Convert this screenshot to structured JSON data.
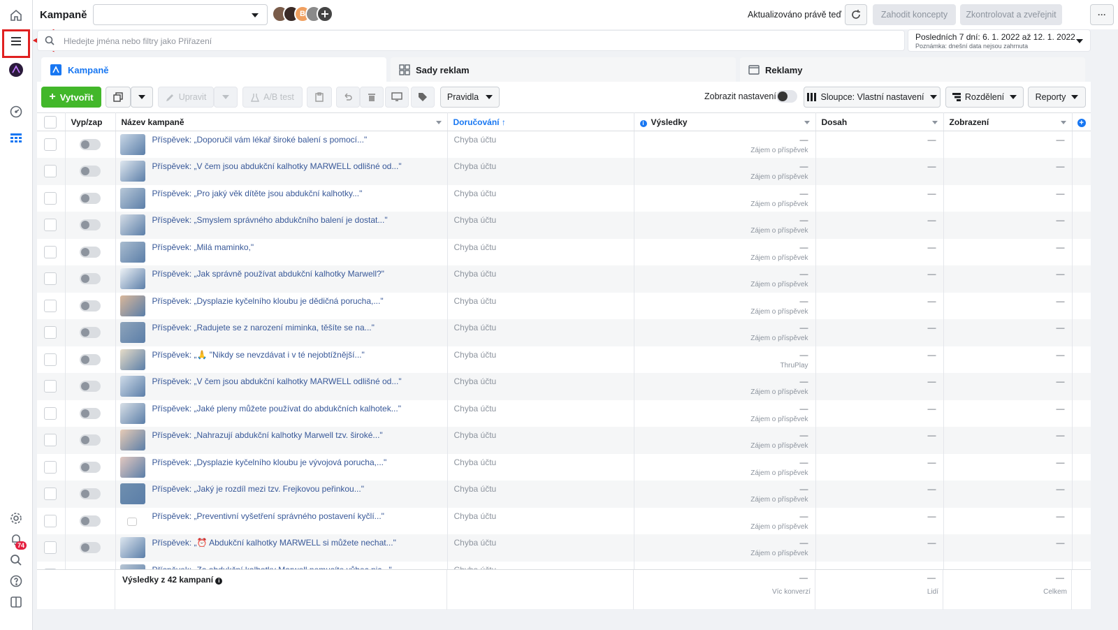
{
  "header": {
    "title": "Kampaně",
    "updated": "Aktualizováno právě teď",
    "discard_label": "Zahodit koncepty",
    "publish_label": "Zkontrolovat a zveřejnit",
    "more_label": "···",
    "avatar_letter": "B"
  },
  "search": {
    "placeholder": "Hledejte jména nebo filtry jako Přiřazení"
  },
  "date_range": {
    "label": "Posledních 7 dní: 6. 1. 2022 až 12. 1. 2022",
    "note": "Poznámka: dnešní data nejsou zahrnuta"
  },
  "tabs": {
    "campaigns": "Kampaně",
    "adsets": "Sady reklam",
    "ads": "Reklamy"
  },
  "toolbar": {
    "create": "Vytvořit",
    "edit": "Upravit",
    "ab_test": "A/B test",
    "rules": "Pravidla",
    "show_settings": "Zobrazit nastavení",
    "columns": "Sloupce: Vlastní nastavení",
    "breakdown": "Rozdělení",
    "reports": "Reporty"
  },
  "columns": {
    "onoff": "Vyp/zap",
    "name": "Název kampaně",
    "delivery": "Doručování",
    "results": "Výsledky",
    "reach": "Dosah",
    "impressions": "Zobrazení"
  },
  "rows": [
    {
      "name": "Příspěvek: „Doporučil vám lékař široké balení s pomocí...\"",
      "delivery": "Chyba účtu",
      "result": "—",
      "result_type": "Zájem o příspěvek",
      "reach": "—",
      "impressions": "—"
    },
    {
      "name": "Příspěvek: „V čem jsou abdukční kalhotky MARWELL odlišné od...\"",
      "delivery": "Chyba účtu",
      "result": "—",
      "result_type": "Zájem o příspěvek",
      "reach": "—",
      "impressions": "—"
    },
    {
      "name": "Příspěvek: „Pro jaký věk dítěte jsou abdukční kalhotky...\"",
      "delivery": "Chyba účtu",
      "result": "—",
      "result_type": "Zájem o příspěvek",
      "reach": "—",
      "impressions": "—"
    },
    {
      "name": "Příspěvek: „Smyslem správného abdukčního balení je dostat...\"",
      "delivery": "Chyba účtu",
      "result": "—",
      "result_type": "Zájem o příspěvek",
      "reach": "—",
      "impressions": "—"
    },
    {
      "name": "Příspěvek: „Milá maminko,\"",
      "delivery": "Chyba účtu",
      "result": "—",
      "result_type": "Zájem o příspěvek",
      "reach": "—",
      "impressions": "—"
    },
    {
      "name": "Příspěvek: „Jak správně používat abdukční kalhotky Marwell?\"",
      "delivery": "Chyba účtu",
      "result": "—",
      "result_type": "Zájem o příspěvek",
      "reach": "—",
      "impressions": "—"
    },
    {
      "name": "Příspěvek: „Dysplazie kyčelního kloubu je dědičná porucha,...\"",
      "delivery": "Chyba účtu",
      "result": "—",
      "result_type": "Zájem o příspěvek",
      "reach": "—",
      "impressions": "—"
    },
    {
      "name": "Příspěvek: „Radujete se z narození miminka, těšíte se na...\"",
      "delivery": "Chyba účtu",
      "result": "—",
      "result_type": "Zájem o příspěvek",
      "reach": "—",
      "impressions": "—"
    },
    {
      "name": "Příspěvek: „🙏 \"Nikdy se nevzdávat i v té nejobtížnější...\"",
      "delivery": "Chyba účtu",
      "result": "—",
      "result_type": "ThruPlay",
      "reach": "—",
      "impressions": "—"
    },
    {
      "name": "Příspěvek: „V čem jsou abdukční kalhotky MARWELL odlišné od...\"",
      "delivery": "Chyba účtu",
      "result": "—",
      "result_type": "Zájem o příspěvek",
      "reach": "—",
      "impressions": "—"
    },
    {
      "name": "Příspěvek: „Jaké pleny můžete používat do abdukčních kalhotek...\"",
      "delivery": "Chyba účtu",
      "result": "—",
      "result_type": "Zájem o příspěvek",
      "reach": "—",
      "impressions": "—"
    },
    {
      "name": "Příspěvek: „Nahrazují abdukční kalhotky Marwell tzv. široké...\"",
      "delivery": "Chyba účtu",
      "result": "—",
      "result_type": "Zájem o příspěvek",
      "reach": "—",
      "impressions": "—"
    },
    {
      "name": "Příspěvek: „Dysplazie kyčelního kloubu je vývojová porucha,...\"",
      "delivery": "Chyba účtu",
      "result": "—",
      "result_type": "Zájem o příspěvek",
      "reach": "—",
      "impressions": "—"
    },
    {
      "name": "Příspěvek: „Jaký je rozdíl mezi tzv. Frejkovou peřinkou...\"",
      "delivery": "Chyba účtu",
      "result": "—",
      "result_type": "Zájem o příspěvek",
      "reach": "—",
      "impressions": "—"
    },
    {
      "name": "Příspěvek: „Preventivní vyšetření správného postavení kyčlí...\"",
      "delivery": "Chyba účtu",
      "result": "—",
      "result_type": "Zájem o příspěvek",
      "reach": "—",
      "impressions": "—"
    },
    {
      "name": "Příspěvek: „⏰ Abdukční kalhotky MARWELL si můžete nechat...\"",
      "delivery": "Chyba účtu",
      "result": "—",
      "result_type": "Zájem o příspěvek",
      "reach": "—",
      "impressions": "—"
    },
    {
      "name": "Příspěvek: „Za abdukční kalhotky Marwell nemusíte vůbec nic...\"",
      "delivery": "Chyba účtu",
      "result": "—",
      "result_type": "",
      "reach": "—",
      "impressions": "—"
    }
  ],
  "summary": {
    "label": "Výsledky z 42 kampaní",
    "results": "—",
    "results_sub": "Víc konverzí",
    "reach": "—",
    "reach_sub": "Lidí",
    "impressions": "—",
    "impressions_sub": "Celkem"
  },
  "notifications": {
    "count": "74"
  },
  "colors": {
    "accent": "#1877f2",
    "create": "#42b72a",
    "highlight": "#e02020"
  }
}
